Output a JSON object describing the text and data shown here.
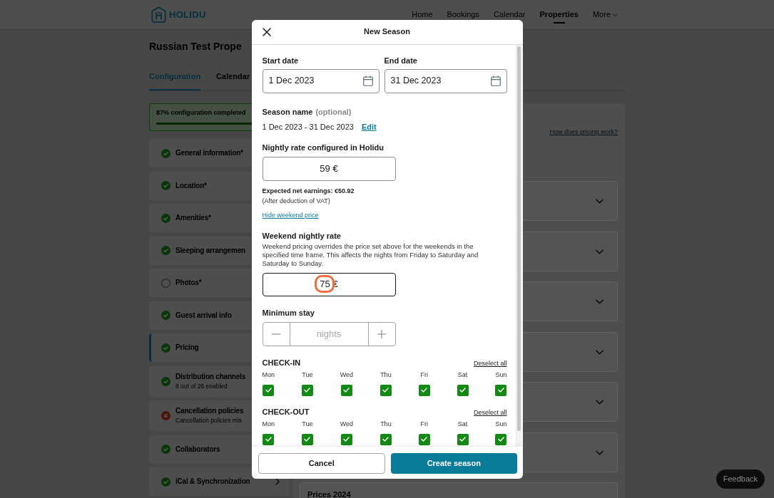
{
  "header": {
    "logo": "HOLIDU",
    "nav": [
      {
        "label": "Home",
        "kind": "link",
        "selected": false
      },
      {
        "label": "Bookings",
        "kind": "link",
        "selected": false
      },
      {
        "label": "Calendar",
        "kind": "link",
        "selected": false
      },
      {
        "label": "Properties",
        "kind": "link",
        "selected": true
      },
      {
        "label": "More",
        "kind": "menu",
        "selected": false
      }
    ]
  },
  "page": {
    "title": "Russian Test Prope",
    "tabs": [
      {
        "label": "Configuration",
        "selected": true
      },
      {
        "label": "Calendar",
        "selected": false
      }
    ],
    "progress": {
      "label": "87% configuration completed",
      "level": 0.87
    },
    "sidebar": {
      "items": [
        {
          "label": "General information*",
          "completed": true,
          "error": false,
          "selected": false
        },
        {
          "label": "Location*",
          "completed": true,
          "error": false,
          "selected": false
        },
        {
          "label": "Amenities*",
          "completed": true,
          "error": false,
          "selected": false
        },
        {
          "label": "Sleeping arrangemen",
          "completed": true,
          "error": false,
          "selected": false
        },
        {
          "label": "Photos*",
          "completed": false,
          "error": false,
          "selected": false
        },
        {
          "label": "Guest arrival info",
          "completed": true,
          "error": false,
          "selected": false
        },
        {
          "label": "Pricing",
          "completed": true,
          "error": false,
          "selected": true
        },
        {
          "label": "Distribution channels",
          "subtitle": "8 out of 26 enabled",
          "completed": true,
          "error": false,
          "selected": false
        },
        {
          "label": "Cancellation policies",
          "subtitle": "Cancellation policies mis",
          "completed": false,
          "error": true,
          "selected": false
        },
        {
          "label": "Collaborators",
          "completed": true,
          "error": false,
          "selected": false
        },
        {
          "label": "iCal & Synchronization",
          "completed": true,
          "error": false,
          "selected": false,
          "chevron": true
        }
      ]
    },
    "pricing_panel": {
      "help_link": "How does pricing work?",
      "sections": [
        {
          "expanded": false
        },
        {
          "expanded": false
        },
        {
          "expanded": false
        },
        {
          "expanded": false
        },
        {
          "expanded": false
        },
        {
          "expanded": false
        },
        {
          "title": "Prices 2024"
        }
      ]
    }
  },
  "modal": {
    "title": "New Season",
    "start_date": {
      "label": "Start date",
      "value": "1 Dec 2023"
    },
    "end_date": {
      "label": "End date",
      "value": "31 Dec 2023"
    },
    "season_name": {
      "label": "Season name",
      "hint": "(optional)",
      "value": "1 Dec 2023 - 31 Dec 2023",
      "action": "Edit"
    },
    "nightly_rate": {
      "label": "Nightly rate configured in Holidu",
      "value": "59 €",
      "earnings": "Expected net earnings: €50.92",
      "earnings_note": "(After deduction of VAT)",
      "toggle_link": "Hide weekend price"
    },
    "weekend_rate": {
      "label": "Weekend nightly rate",
      "description": "Weekend pricing overrides the price set above for the weekends in the specified time frame. This affects the nights from Friday to Saturday and Saturday to Sunday.",
      "value": "75 €",
      "focused": true,
      "annotated": true
    },
    "minimum_stay": {
      "label": "Minimum stay",
      "placeholder": "nights"
    },
    "check_in": {
      "title": "CHECK-IN",
      "action": "Deselect all",
      "days": [
        {
          "label": "Mon",
          "checked": true
        },
        {
          "label": "Tue",
          "checked": true
        },
        {
          "label": "Wed",
          "checked": true
        },
        {
          "label": "Thu",
          "checked": true
        },
        {
          "label": "Fri",
          "checked": true
        },
        {
          "label": "Sat",
          "checked": true
        },
        {
          "label": "Sun",
          "checked": true
        }
      ]
    },
    "check_out": {
      "title": "CHECK-OUT",
      "action": "Deselect all",
      "days": [
        {
          "label": "Mon",
          "checked": true
        },
        {
          "label": "Tue",
          "checked": true
        },
        {
          "label": "Wed",
          "checked": true
        },
        {
          "label": "Thu",
          "checked": true
        },
        {
          "label": "Fri",
          "checked": true
        },
        {
          "label": "Sat",
          "checked": true
        },
        {
          "label": "Sun",
          "checked": true
        }
      ]
    },
    "buttons": [
      {
        "label": "Cancel",
        "kind": "secondary"
      },
      {
        "label": "Create season",
        "kind": "primary"
      }
    ]
  },
  "feedback_button": "Feedback"
}
